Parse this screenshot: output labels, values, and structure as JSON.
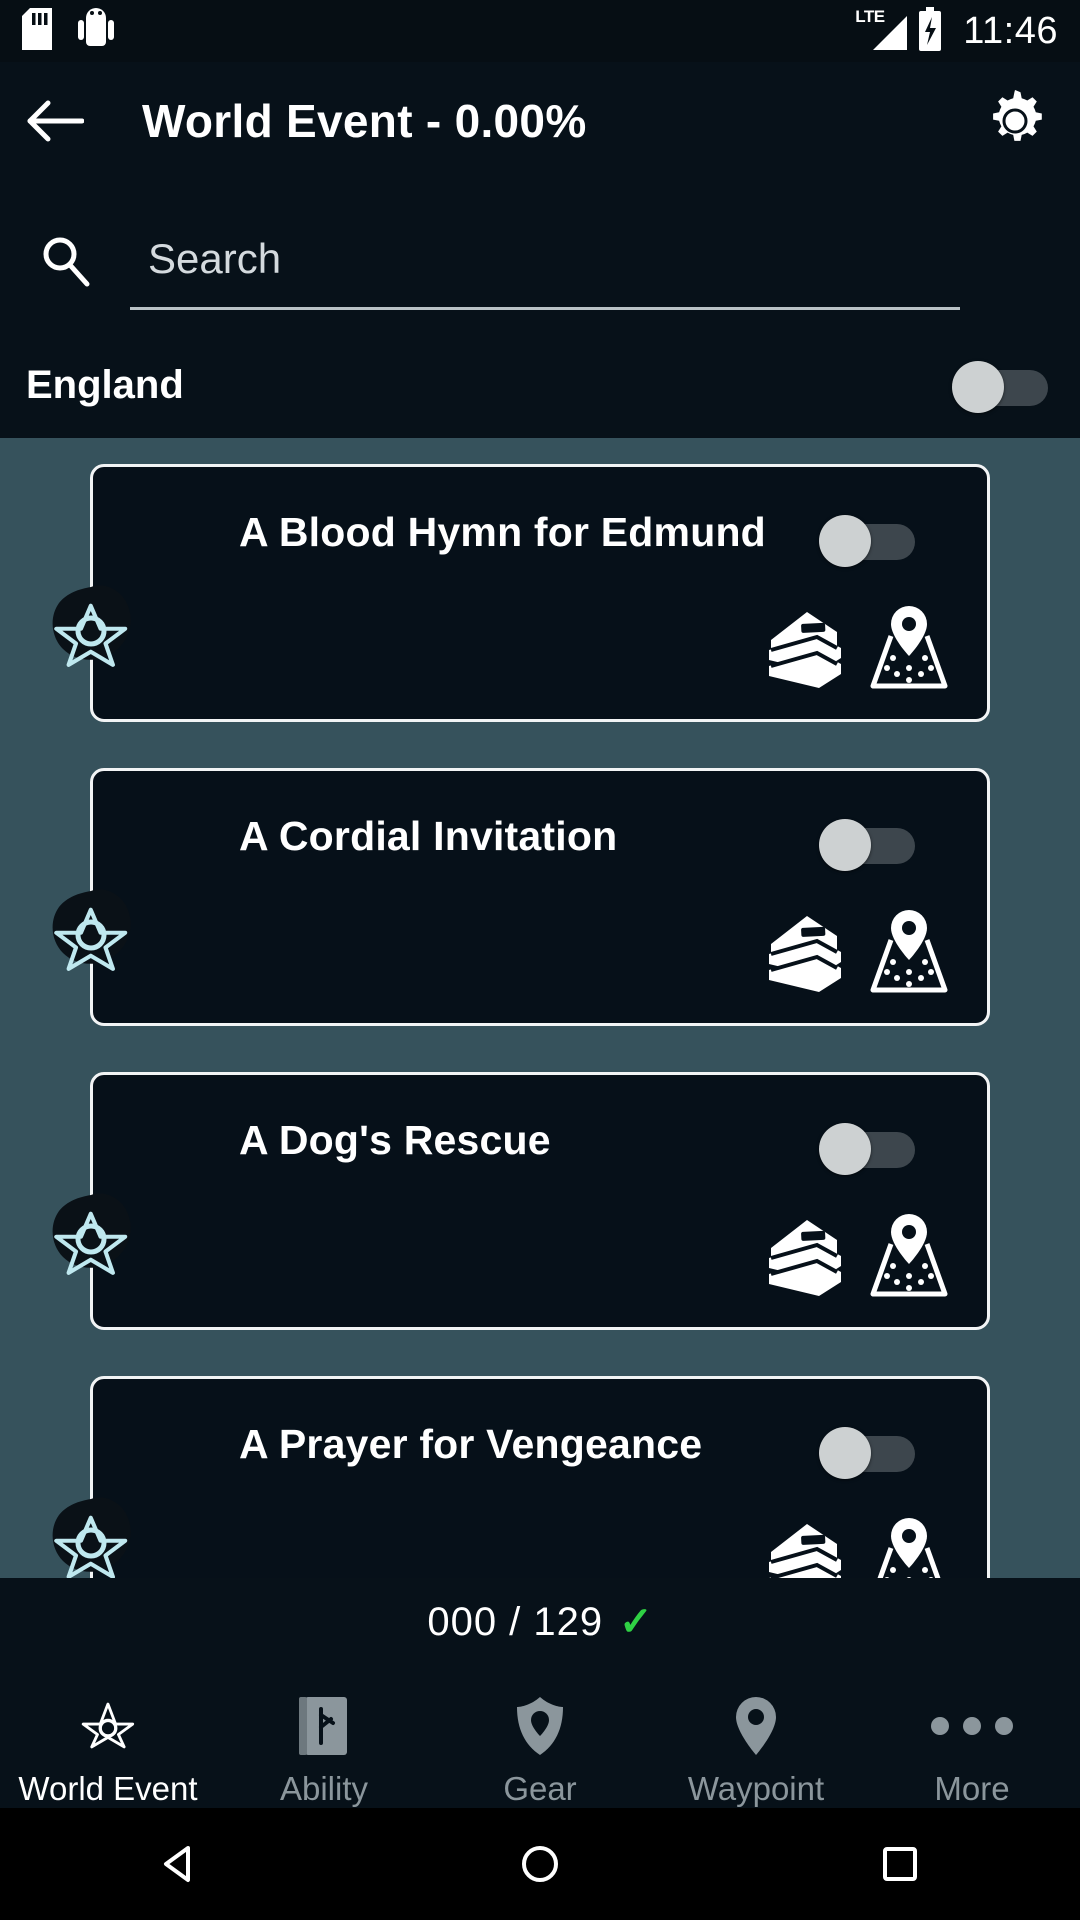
{
  "status_bar": {
    "icons": [
      "sd-card-icon",
      "android-robot-icon"
    ],
    "network": "LTE",
    "battery": "charging",
    "time": "11:46"
  },
  "app_bar": {
    "back_label": "back-arrow",
    "title": "World Event - 0.00%",
    "settings_label": "settings"
  },
  "search": {
    "placeholder": "Search",
    "value": ""
  },
  "region": {
    "name": "England",
    "toggle_state": "off"
  },
  "colors": {
    "page_background": "#36525c",
    "panel_background": "#071119",
    "card_background": "#061019",
    "card_border": "#f2f4f5",
    "accent_star": "#bfe8ef",
    "check_green": "#2fd144",
    "toggle_knob": "#cdd1d2",
    "toggle_track": "#3d464d",
    "inactive_nav": "#8b969c"
  },
  "list": {
    "items": [
      {
        "title": "A Blood Hymn for Edmund",
        "toggle_state": "off",
        "icons": [
          "book-icon",
          "map-pin-icon"
        ],
        "collectible_icon": "world-event-star-icon"
      },
      {
        "title": "A Cordial Invitation",
        "toggle_state": "off",
        "icons": [
          "book-icon",
          "map-pin-icon"
        ],
        "collectible_icon": "world-event-star-icon"
      },
      {
        "title": "A Dog's Rescue",
        "toggle_state": "off",
        "icons": [
          "book-icon",
          "map-pin-icon"
        ],
        "collectible_icon": "world-event-star-icon"
      },
      {
        "title": "A Prayer for Vengeance",
        "toggle_state": "off",
        "icons": [
          "book-icon",
          "map-pin-icon"
        ],
        "collectible_icon": "world-event-star-icon"
      }
    ]
  },
  "counter": {
    "text": "000 / 129",
    "check": "✓"
  },
  "bottom_nav": {
    "items": [
      {
        "label": "World Event",
        "icon": "star-icon",
        "active": true
      },
      {
        "label": "Ability",
        "icon": "book-rune-icon",
        "active": false
      },
      {
        "label": "Gear",
        "icon": "armor-icon",
        "active": false
      },
      {
        "label": "Waypoint",
        "icon": "map-pin-icon",
        "active": false
      },
      {
        "label": "More",
        "icon": "more-dots-icon",
        "active": false
      }
    ]
  },
  "system_nav": {
    "back": "triangle-back-icon",
    "home": "circle-home-icon",
    "recents": "square-recents-icon"
  }
}
